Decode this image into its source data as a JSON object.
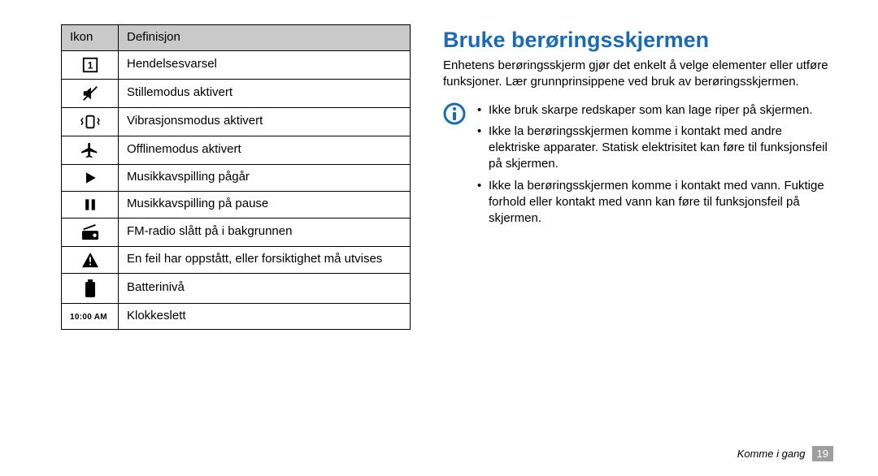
{
  "table": {
    "header_icon": "Ikon",
    "header_def": "Definisjon",
    "rows": [
      {
        "icon": "calendar-alert",
        "def": "Hendelsesvarsel"
      },
      {
        "icon": "mute",
        "def": "Stillemodus aktivert"
      },
      {
        "icon": "vibrate",
        "def": "Vibrasjonsmodus aktivert"
      },
      {
        "icon": "airplane",
        "def": "Offlinemodus aktivert"
      },
      {
        "icon": "play",
        "def": "Musikkavspilling pågår"
      },
      {
        "icon": "pause",
        "def": "Musikkavspilling på pause"
      },
      {
        "icon": "radio",
        "def": "FM-radio slått på i bakgrunnen"
      },
      {
        "icon": "warning",
        "def": "En feil har oppstått, eller forsiktighet må utvises"
      },
      {
        "icon": "battery",
        "def": "Batterinivå"
      },
      {
        "icon": "clock",
        "def": "Klokkeslett",
        "time": "10:00 AM"
      }
    ]
  },
  "title": "Bruke berøringsskjermen",
  "intro": "Enhetens berøringsskjerm gjør det enkelt å velge elementer eller utføre funksjoner. Lær grunnprinsippene ved bruk av berøringsskjermen.",
  "notices": [
    "Ikke bruk skarpe redskaper som kan lage riper på skjermen.",
    "Ikke la berøringsskjermen komme i kontakt med andre elektriske apparater. Statisk elektrisitet kan føre til funksjonsfeil på skjermen.",
    "Ikke la berøringsskjermen komme i kontakt med vann. Fuktige forhold eller kontakt med vann kan føre til funksjonsfeil på skjermen."
  ],
  "footer_section": "Komme i gang",
  "page_number": "19"
}
